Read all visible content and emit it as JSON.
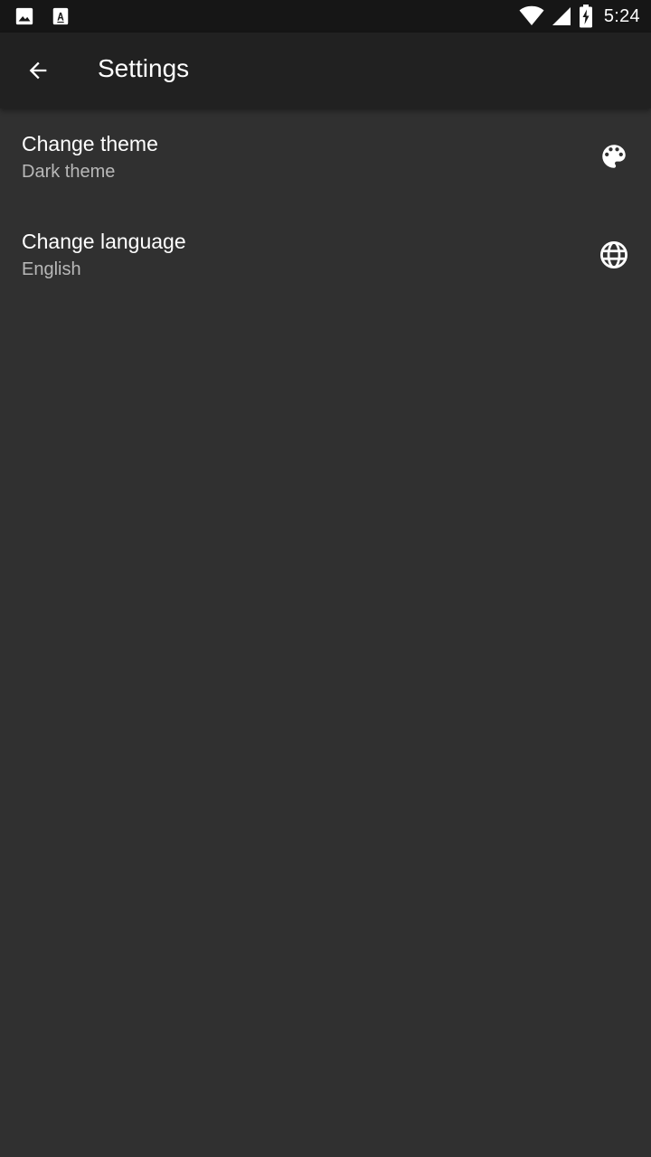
{
  "status_bar": {
    "time": "5:24",
    "icons": [
      "image-icon",
      "font-download-icon",
      "wifi-icon",
      "signal-icon",
      "battery-charging-icon"
    ]
  },
  "app_bar": {
    "title": "Settings",
    "back_icon": "arrow-back-icon"
  },
  "settings": {
    "items": [
      {
        "title": "Change theme",
        "subtitle": "Dark theme",
        "icon": "palette-icon"
      },
      {
        "title": "Change language",
        "subtitle": "English",
        "icon": "globe-icon"
      }
    ]
  },
  "colors": {
    "background": "#303030",
    "app_bar": "#212121",
    "status_bar": "#161616",
    "text_primary": "#ffffff",
    "text_secondary": "#b8b8b8"
  }
}
